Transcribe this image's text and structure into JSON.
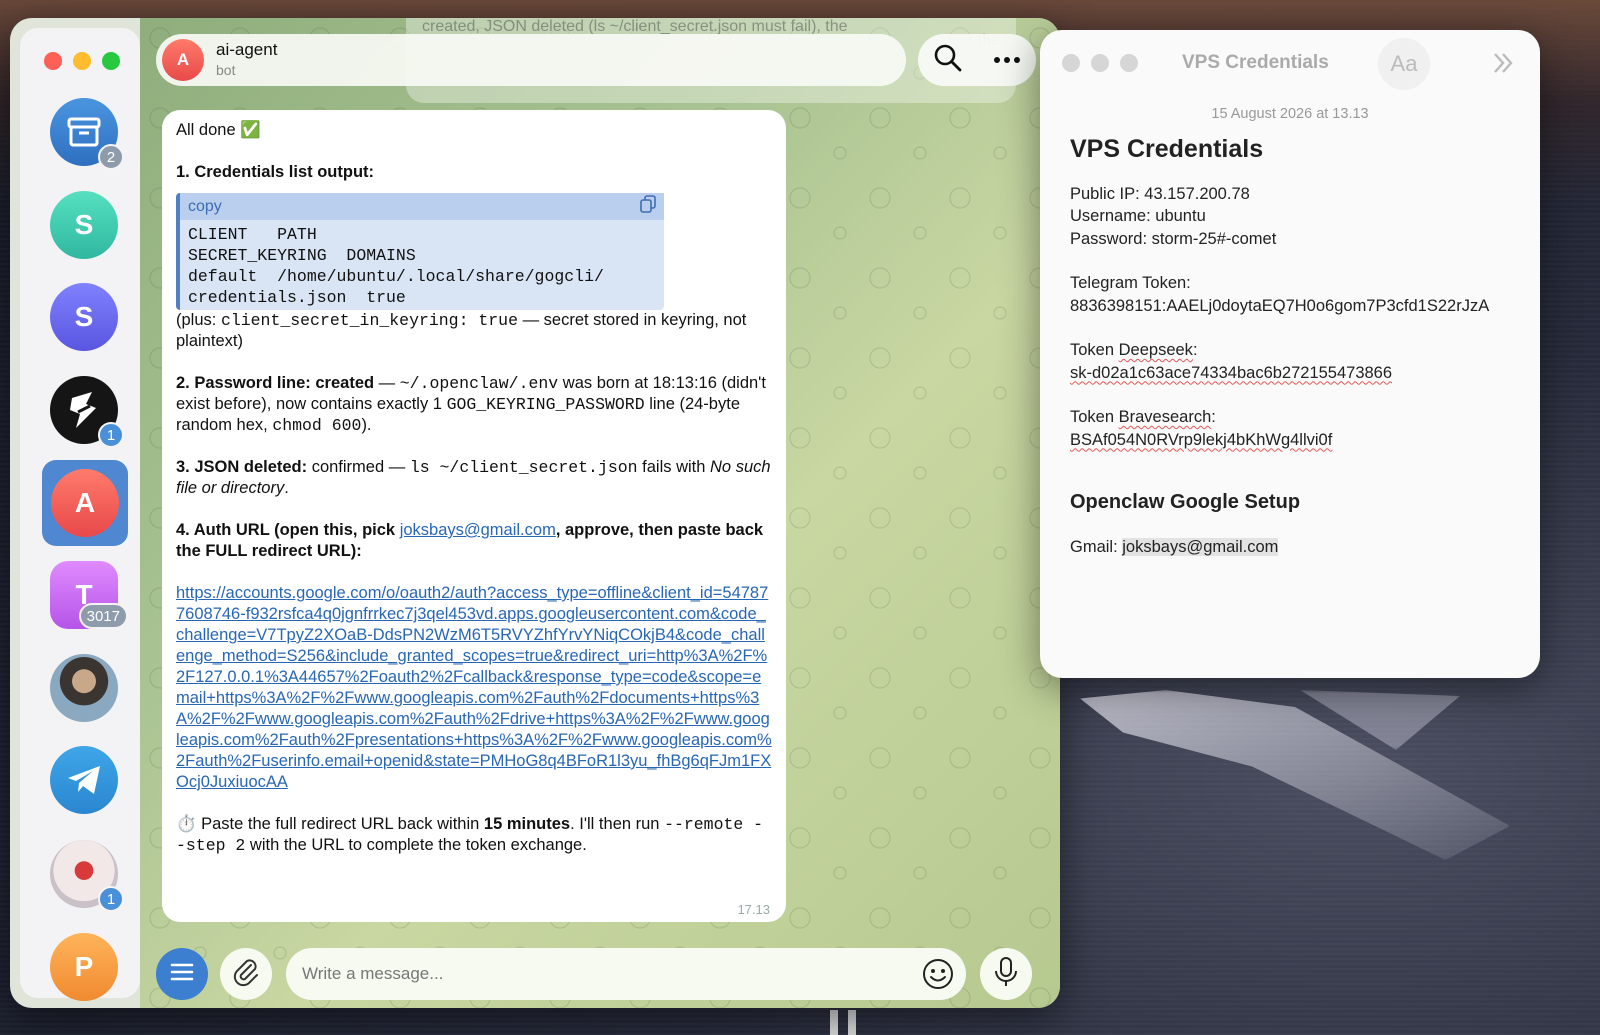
{
  "telegram": {
    "chat": {
      "title": "ai-agent",
      "subtitle": "bot",
      "avatar_letter": "A"
    },
    "peek_text": "created, JSON deleted (ls ~/client_secret.json must fail), the",
    "peek_text_right": "the",
    "sidebar": [
      {
        "id": "archive",
        "letter": "",
        "badge": "2",
        "color": "#3a7fd0"
      },
      {
        "id": "s1",
        "letter": "S",
        "badge": "",
        "color": "#3fcfb0"
      },
      {
        "id": "s2",
        "letter": "S",
        "badge": "",
        "color": "#6a6cf0"
      },
      {
        "id": "dark",
        "letter": "",
        "badge": "1",
        "color": "#111111"
      },
      {
        "id": "ai-agent",
        "letter": "A",
        "badge": "",
        "color": "#f0605a"
      },
      {
        "id": "t",
        "letter": "T",
        "badge": "3017",
        "color": "#c86af0"
      },
      {
        "id": "photo1",
        "letter": "",
        "badge": "",
        "color": "#7a8b9a"
      },
      {
        "id": "telegram",
        "letter": "",
        "badge": "",
        "color": "#3a9ad8"
      },
      {
        "id": "photo2",
        "letter": "",
        "badge": "1",
        "color": "#d9d0d0"
      },
      {
        "id": "p",
        "letter": "P",
        "badge": "",
        "color": "#f5a743"
      }
    ],
    "message": {
      "intro": "All done ✅",
      "s1_title": "1. Credentials list output:",
      "code_header": "copy",
      "code_lines": "CLIENT   PATH\nSECRET_KEYRING  DOMAINS\ndefault  /home/ubuntu/.local/share/gogcli/\ncredentials.json  true",
      "s1_note_pre": "(plus: ",
      "s1_note_code": "client_secret_in_keyring: true",
      "s1_note_post": " — secret stored in keyring, not plaintext)",
      "s2_title": "2. Password line: created",
      "s2_a": " — ",
      "s2_code1": "~/.openclaw/.env",
      "s2_b": " was born at 18:13:16 (didn't exist before), now contains exactly 1 ",
      "s2_code2": "GOG_KEYRING_PASSWORD",
      "s2_c": " line (24-byte random hex, ",
      "s2_code3": "chmod 600",
      "s2_d": ").",
      "s3_title": "3. JSON deleted:",
      "s3_a": " confirmed — ",
      "s3_code": "ls ~/client_secret.json",
      "s3_b": " fails with ",
      "s3_italic": "No such file or directory",
      "s3_c": ".",
      "s4_title_a": "4. Auth URL (open this, pick ",
      "s4_email": "joksbays@gmail.com",
      "s4_title_b": ", approve, then paste back the FULL redirect URL):",
      "auth_url": "https://accounts.google.com/o/oauth2/auth?access_type=offline&client_id=547877608746-f932rsfca4q0jgnfrrkec7j3qel453vd.apps.googleusercontent.com&code_challenge=V7TpyZ2XOaB-DdsPN2WzM6T5RVYZhfYrvYNiqCOkjB4&code_challenge_method=S256&include_granted_scopes=true&redirect_uri=http%3A%2F%2F127.0.0.1%3A44657%2Foauth2%2Fcallback&response_type=code&scope=email+https%3A%2F%2Fwww.googleapis.com%2Fauth%2Fdocuments+https%3A%2F%2Fwww.googleapis.com%2Fauth%2Fdrive+https%3A%2F%2Fwww.googleapis.com%2Fauth%2Fpresentations+https%3A%2F%2Fwww.googleapis.com%2Fauth%2Fuserinfo.email+openid&state=PMHoG8q4BFoR1l3yu_fhBg6qFJm1FXOcj0JuxiuocAA",
      "final_a": "⏱️ Paste the full redirect URL back within ",
      "final_bold": "15 minutes",
      "final_b": ". I'll then run ",
      "final_code": "--remote --step 2",
      "final_c": " with the URL to complete the token exchange.",
      "time": "17.13"
    },
    "composer": {
      "placeholder": "Write a message..."
    }
  },
  "notes": {
    "window_title": "VPS Credentials",
    "format_button": "Aa",
    "date": "15 August 2026 at 13.13",
    "heading": "VPS Credentials",
    "public_ip": "Public IP: 43.157.200.78",
    "username": "Username: ubuntu",
    "password": "Password: storm-25#-comet",
    "telegram_label": "Telegram Token:",
    "telegram_token": "8836398151:AAELj0doytaEQ7H0o6gom7P3cfd1S22rJzA",
    "deepseek_label_a": "Token ",
    "deepseek_label_b": "Deepseek",
    "deepseek_label_c": ":",
    "deepseek_token": "sk-d02a1c63ace74334bac6b272155473866",
    "brave_label_a": "Token ",
    "brave_label_b": "Bravesearch",
    "brave_label_c": ":",
    "brave_token": "BSAf054N0RVrp9lekj4bKhWg4llvi0f",
    "section2": "Openclaw Google Setup",
    "gmail_label": "Gmail: ",
    "gmail_value": "joksbays@gmail.com"
  }
}
